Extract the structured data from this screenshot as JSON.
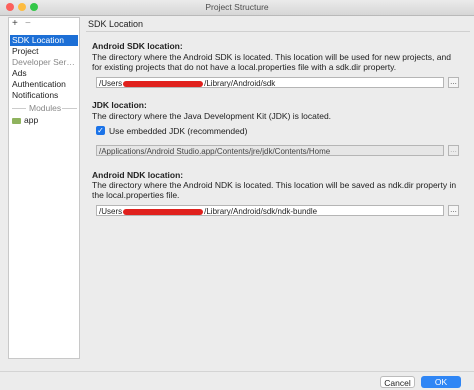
{
  "window": {
    "title": "Project Structure"
  },
  "toolbar": {
    "add": "+",
    "remove": "−"
  },
  "nav": {
    "items": [
      {
        "label": "SDK Location",
        "selected": true
      },
      {
        "label": "Project"
      },
      {
        "label": "Developer Ser…",
        "header": true
      },
      {
        "label": "Ads"
      },
      {
        "label": "Authentication"
      },
      {
        "label": "Notifications"
      }
    ],
    "modules_header": "Modules",
    "modules": [
      {
        "label": "app"
      }
    ]
  },
  "panel": {
    "title": "SDK Location"
  },
  "android_sdk": {
    "title": "Android SDK location:",
    "description": "The directory where the Android SDK is located. This location will be used for new projects, and for existing projects that do not have a local.properties file with a sdk.dir property.",
    "path_prefix": "/Users",
    "path_suffix": "/Library/Android/sdk",
    "browse": "..."
  },
  "jdk": {
    "title": "JDK location:",
    "description": "The directory where the Java Development Kit (JDK) is located.",
    "embedded_label": "Use embedded JDK (recommended)",
    "embedded_checked": true,
    "path": "/Applications/Android Studio.app/Contents/jre/jdk/Contents/Home",
    "browse": "..."
  },
  "android_ndk": {
    "title": "Android NDK location:",
    "description": "The directory where the Android NDK is located. This location will be saved as ndk.dir property in the local.properties file.",
    "path_prefix": "/Users",
    "path_suffix": "/Library/Android/sdk/ndk-bundle",
    "browse": "..."
  },
  "buttons": {
    "cancel": "Cancel",
    "ok": "OK"
  },
  "colors": {
    "selection": "#1c6fd6",
    "ok_button": "#2f86f5",
    "redaction": "#e0211d"
  }
}
